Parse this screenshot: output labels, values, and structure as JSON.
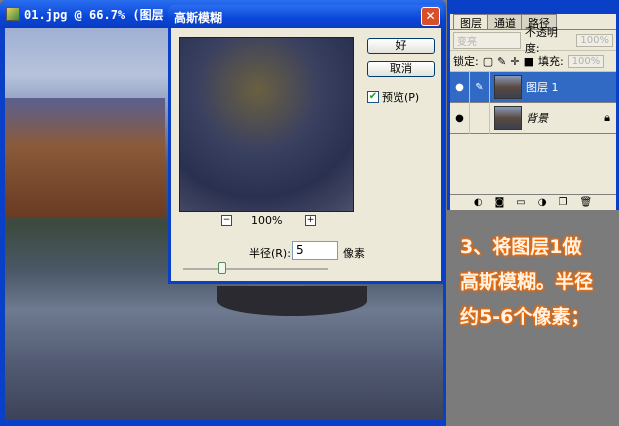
{
  "document": {
    "title": "01.jpg @ 66.7% (图层 1"
  },
  "dialog": {
    "title": "高斯模糊",
    "close": "✕",
    "ok": "好",
    "cancel": "取消",
    "preview_label": "预览(P)",
    "preview_checked": true,
    "zoom": "100%",
    "zoom_out": "−",
    "zoom_in": "+",
    "radius_label": "半径(R):",
    "radius_value": "5",
    "radius_unit": "像素"
  },
  "layers_panel": {
    "tabs": [
      "图层",
      "通道",
      "路径"
    ],
    "blend_mode": "变亮",
    "opacity_label": "不透明度:",
    "opacity_value": "100%",
    "lock_label": "锁定:",
    "fill_label": "填充:",
    "fill_value": "100%",
    "layers": [
      {
        "name": "图层 1",
        "selected": true
      },
      {
        "name": "背景",
        "selected": false
      }
    ]
  },
  "note": {
    "lines": [
      "3、将图层1做",
      "高斯模糊。半径",
      "约5-6个像素；"
    ]
  }
}
